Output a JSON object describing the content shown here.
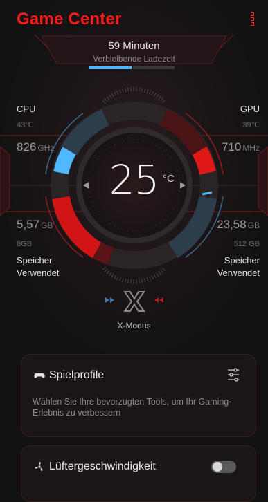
{
  "header": {
    "title": "Game Center",
    "menu_icon": "more-vert-icon"
  },
  "charge": {
    "time": "59 Minuten",
    "label": "Verbleibende Ladezeit"
  },
  "cpu": {
    "label": "CPU",
    "temp": "43℃",
    "freq_value": "826",
    "freq_unit": "GHz"
  },
  "gpu": {
    "label": "GPU",
    "temp": "39℃",
    "freq_value": "710",
    "freq_unit": "MHz"
  },
  "storage": {
    "used_value": "5,57",
    "used_unit": "GB",
    "total": "8GB",
    "label_line1": "Speicher",
    "label_line2": "Verwendet"
  },
  "memory": {
    "used_value": "23,58",
    "used_unit": "GB",
    "total": "512 GB",
    "label_line1": "Speicher",
    "label_line2": "Verwendet"
  },
  "temperature": {
    "value": "25",
    "unit": "°C"
  },
  "xmode": {
    "label": "X-Modus"
  },
  "cards": {
    "profiles": {
      "title": "Spielprofile",
      "description": "Wählen Sie Ihre bevorzugten Tools, um Ihr Gaming-Erlebnis zu verbessern"
    },
    "fan": {
      "title": "Lüftergeschwindigkeit",
      "enabled": false
    }
  },
  "colors": {
    "accent": "#ff1a1a",
    "blue": "#4fb8ff",
    "bg": "#121212"
  }
}
